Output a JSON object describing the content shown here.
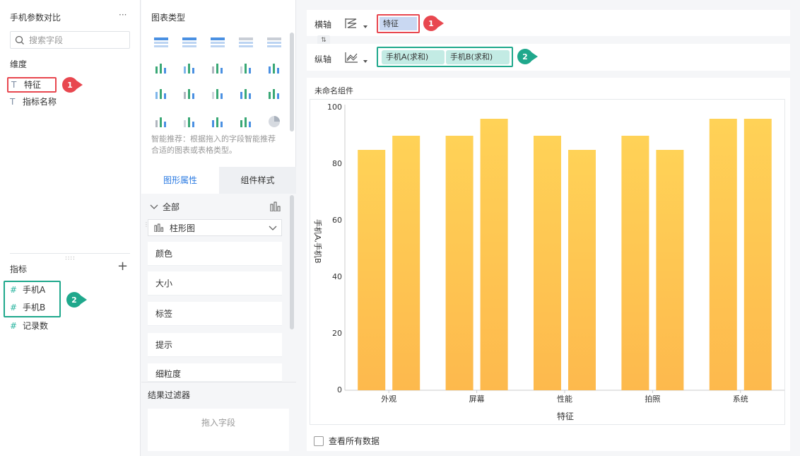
{
  "left_panel": {
    "dataset_title": "手机参数对比",
    "more_label": "···",
    "search_placeholder": "搜索字段",
    "dimension_header": "维度",
    "dimensions": [
      {
        "icon": "T",
        "label": "特征"
      },
      {
        "icon": "T",
        "label": "指标名称"
      }
    ],
    "measure_header": "指标",
    "add_label": "+",
    "measures": [
      {
        "icon": "#",
        "label": "手机A"
      },
      {
        "icon": "#",
        "label": "手机B"
      },
      {
        "icon": "#",
        "label": "记录数"
      }
    ]
  },
  "middle_panel": {
    "chart_type_header": "图表类型",
    "smart_hint": "智能推荐：根据拖入的字段智能推荐合适的图表或表格类型。",
    "tab_properties": "图形属性",
    "tab_style": "组件样式",
    "all_label": "全部",
    "chart_select_label": "柱形图",
    "props": [
      "颜色",
      "大小",
      "标签",
      "提示",
      "细粒度"
    ],
    "filter_header": "结果过滤器",
    "drop_hint": "拖入字段"
  },
  "axes_bar": {
    "x_label": "横轴",
    "y_label": "纵轴",
    "x_field": "特征",
    "y_fields": [
      "手机A(求和)",
      "手机B(求和)"
    ]
  },
  "callouts": {
    "one": "1",
    "two": "2"
  },
  "component": {
    "title": "未命名组件",
    "view_all_label": "查看所有数据"
  },
  "chart_data": {
    "type": "bar",
    "categories": [
      "外观",
      "屏幕",
      "性能",
      "拍照",
      "系统"
    ],
    "series": [
      {
        "name": "手机A",
        "values": [
          85,
          90,
          90,
          90,
          96
        ]
      },
      {
        "name": "手机B",
        "values": [
          90,
          96,
          85,
          85,
          96
        ]
      }
    ],
    "xlabel": "特征",
    "ylabel": "手机A,手机B",
    "yticks": [
      "0",
      "20",
      "40",
      "60",
      "80",
      "100"
    ],
    "ylim": [
      0,
      100
    ],
    "bar_color_top": "#ffd257",
    "bar_color_bottom": "#fdb94d"
  },
  "colors": {
    "accent": "#2a7ae2",
    "red": "#e8474f",
    "green": "#1fa88c"
  }
}
